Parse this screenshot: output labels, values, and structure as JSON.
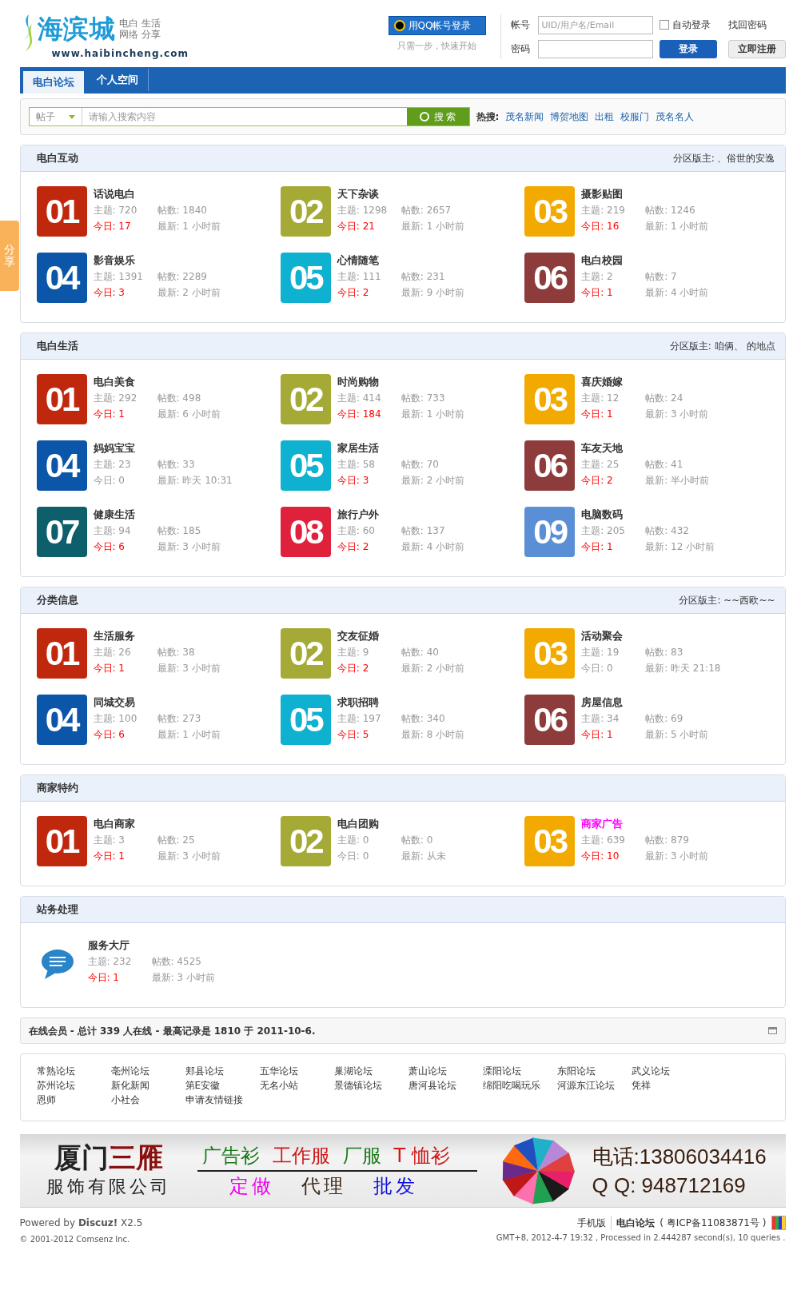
{
  "header": {
    "logo_name": "海滨城",
    "tagline_1": "电白 生活",
    "tagline_2": "网络 分享",
    "url": "www.haibincheng.com",
    "qq_login": "用QQ帐号登录",
    "qq_hint": "只需一步，快速开始",
    "account_label": "帐号",
    "account_placeholder": "UID/用户名/Email",
    "password_label": "密码",
    "auto_login": {
      "label": "自动登录",
      "checked": false
    },
    "forgot": "找回密码",
    "login_button": "登录",
    "register_button": "立即注册"
  },
  "nav": [
    {
      "label": "电白论坛",
      "selected": true
    },
    {
      "label": "个人空间",
      "selected": false
    }
  ],
  "search": {
    "type": "帖子",
    "placeholder": "请输入搜索内容",
    "button": "搜 索",
    "hot_label": "热搜:",
    "hot": [
      "茂名新闻",
      "博贺地图",
      "出租",
      "校服门",
      "茂名名人"
    ]
  },
  "share": "分享",
  "sections": [
    {
      "title": "电白互动",
      "moderators": "分区版主: 、俗世的安逸",
      "forums": [
        {
          "kind": "tile",
          "num": "01",
          "color": "#c0280e",
          "name": "话说电白",
          "topics": "主题: 720",
          "posts": "帖数: 1840",
          "today": "今日: 17",
          "today_active": true,
          "latest": "最新: 1 小时前"
        },
        {
          "kind": "tile",
          "num": "02",
          "color": "#a5aa36",
          "name": "天下杂谈",
          "topics": "主题: 1298",
          "posts": "帖数: 2657",
          "today": "今日: 21",
          "today_active": true,
          "latest": "最新: 1 小时前"
        },
        {
          "kind": "tile",
          "num": "03",
          "color": "#f2aa00",
          "name": "摄影贴图",
          "topics": "主题: 219",
          "posts": "帖数: 1246",
          "today": "今日: 16",
          "today_active": true,
          "latest": "最新: 1 小时前"
        },
        {
          "kind": "tile",
          "num": "04",
          "color": "#0b56a8",
          "name": "影音娱乐",
          "topics": "主题: 1391",
          "posts": "帖数: 2289",
          "today": "今日: 3",
          "today_active": true,
          "latest": "最新: 2 小时前"
        },
        {
          "kind": "tile",
          "num": "05",
          "color": "#0fb1d0",
          "name": "心情随笔",
          "topics": "主题: 111",
          "posts": "帖数: 231",
          "today": "今日: 2",
          "today_active": true,
          "latest": "最新: 9 小时前"
        },
        {
          "kind": "tile",
          "num": "06",
          "color": "#8d3b3b",
          "name": "电白校园",
          "topics": "主题: 2",
          "posts": "帖数: 7",
          "today": "今日: 1",
          "today_active": true,
          "latest": "最新: 4 小时前"
        }
      ]
    },
    {
      "title": "电白生活",
      "moderators": "分区版主: 咱俩、 的地点",
      "forums": [
        {
          "kind": "tile",
          "num": "01",
          "color": "#c0280e",
          "name": "电白美食",
          "topics": "主题: 292",
          "posts": "帖数: 498",
          "today": "今日: 1",
          "today_active": true,
          "latest": "最新: 6 小时前"
        },
        {
          "kind": "tile",
          "num": "02",
          "color": "#a5aa36",
          "name": "时尚购物",
          "topics": "主题: 414",
          "posts": "帖数: 733",
          "today": "今日: 184",
          "today_active": true,
          "latest": "最新: 1 小时前"
        },
        {
          "kind": "tile",
          "num": "03",
          "color": "#f2aa00",
          "name": "喜庆婚嫁",
          "topics": "主题: 12",
          "posts": "帖数: 24",
          "today": "今日: 1",
          "today_active": true,
          "latest": "最新: 3 小时前"
        },
        {
          "kind": "tile",
          "num": "04",
          "color": "#0b56a8",
          "name": "妈妈宝宝",
          "topics": "主题: 23",
          "posts": "帖数: 33",
          "today": "今日: 0",
          "today_active": false,
          "latest": "最新: 昨天 10:31"
        },
        {
          "kind": "tile",
          "num": "05",
          "color": "#0fb1d0",
          "name": "家居生活",
          "topics": "主题: 58",
          "posts": "帖数: 70",
          "today": "今日: 3",
          "today_active": true,
          "latest": "最新: 2 小时前"
        },
        {
          "kind": "tile",
          "num": "06",
          "color": "#8d3b3b",
          "name": "车友天地",
          "topics": "主题: 25",
          "posts": "帖数: 41",
          "today": "今日: 2",
          "today_active": true,
          "latest": "最新: 半小时前"
        },
        {
          "kind": "tile",
          "num": "07",
          "color": "#0c5f6b",
          "name": "健康生活",
          "topics": "主题: 94",
          "posts": "帖数: 185",
          "today": "今日: 6",
          "today_active": true,
          "latest": "最新: 3 小时前"
        },
        {
          "kind": "tile",
          "num": "08",
          "color": "#e0213b",
          "name": "旅行户外",
          "topics": "主题: 60",
          "posts": "帖数: 137",
          "today": "今日: 2",
          "today_active": true,
          "latest": "最新: 4 小时前"
        },
        {
          "kind": "tile",
          "num": "09",
          "color": "#5a8fd5",
          "name": "电脑数码",
          "topics": "主题: 205",
          "posts": "帖数: 432",
          "today": "今日: 1",
          "today_active": true,
          "latest": "最新: 12 小时前"
        }
      ]
    },
    {
      "title": "分类信息",
      "moderators": "分区版主: ~~西欧~~",
      "forums": [
        {
          "kind": "tile",
          "num": "01",
          "color": "#c0280e",
          "name": "生活服务",
          "topics": "主题: 26",
          "posts": "帖数: 38",
          "today": "今日: 1",
          "today_active": true,
          "latest": "最新: 3 小时前"
        },
        {
          "kind": "tile",
          "num": "02",
          "color": "#a5aa36",
          "name": "交友征婚",
          "topics": "主题: 9",
          "posts": "帖数: 40",
          "today": "今日: 2",
          "today_active": true,
          "latest": "最新: 2 小时前"
        },
        {
          "kind": "tile",
          "num": "03",
          "color": "#f2aa00",
          "name": "活动聚会",
          "topics": "主题: 19",
          "posts": "帖数: 83",
          "today": "今日: 0",
          "today_active": false,
          "latest": "最新: 昨天 21:18"
        },
        {
          "kind": "tile",
          "num": "04",
          "color": "#0b56a8",
          "name": "同城交易",
          "topics": "主题: 100",
          "posts": "帖数: 273",
          "today": "今日: 6",
          "today_active": true,
          "latest": "最新: 1 小时前"
        },
        {
          "kind": "tile",
          "num": "05",
          "color": "#0fb1d0",
          "name": "求职招聘",
          "topics": "主题: 197",
          "posts": "帖数: 340",
          "today": "今日: 5",
          "today_active": true,
          "latest": "最新: 8 小时前"
        },
        {
          "kind": "tile",
          "num": "06",
          "color": "#8d3b3b",
          "name": "房屋信息",
          "topics": "主题: 34",
          "posts": "帖数: 69",
          "today": "今日: 1",
          "today_active": true,
          "latest": "最新: 5 小时前"
        }
      ]
    },
    {
      "title": "商家特约",
      "forums": [
        {
          "kind": "tile",
          "num": "01",
          "color": "#c0280e",
          "name": "电白商家",
          "name_highlighted": false,
          "topics": "主题: 3",
          "posts": "帖数: 25",
          "today": "今日: 1",
          "today_active": true,
          "latest": "最新: 3 小时前"
        },
        {
          "kind": "tile",
          "num": "02",
          "color": "#a5aa36",
          "name": "电白团购",
          "name_highlighted": false,
          "topics": "主题: 0",
          "posts": "帖数: 0",
          "today": "今日: 0",
          "today_active": false,
          "latest": "最新: 从未"
        },
        {
          "kind": "tile",
          "num": "03",
          "color": "#f2aa00",
          "name": "商家广告",
          "name_highlighted": true,
          "topics": "主题: 639",
          "posts": "帖数: 879",
          "today": "今日: 10",
          "today_active": true,
          "latest": "最新: 3 小时前"
        }
      ]
    },
    {
      "title": "站务处理",
      "forums": [
        {
          "kind": "icon",
          "name": "服务大厅",
          "topics": "主题: 232",
          "posts": "帖数: 4525",
          "today": "今日: 1",
          "today_active": true,
          "latest": "最新: 3 小时前"
        }
      ]
    }
  ],
  "online": "在线会员 - 总计 339 人在线 - 最高记录是 1810 于 2011-10-6.",
  "links": [
    "常熟论坛",
    "亳州论坛",
    "郏县论坛",
    "五华论坛",
    "巢湖论坛",
    "萧山论坛",
    "溧阳论坛",
    "东阳论坛",
    "武义论坛",
    "苏州论坛",
    "新化新闻",
    "第E安徽",
    "无名小站",
    "景德镇论坛",
    "唐河县论坛",
    "绵阳吃喝玩乐",
    "河源东江论坛",
    "凭祥",
    "恩师",
    "小社会",
    "申请友情链接"
  ],
  "banner": {
    "company_1": "厦门",
    "company_2": "三雁",
    "company_sub": "服饰有限公司",
    "products": [
      {
        "text": "广告衫",
        "color": "#1a7a1a"
      },
      {
        "text": "工作服",
        "color": "#d01818"
      },
      {
        "text": "厂服",
        "color": "#1a7a1a"
      },
      {
        "text": "T 恤衫",
        "color": "#d01818"
      }
    ],
    "services": [
      {
        "text": "定做",
        "color": "#ee00ee"
      },
      {
        "text": "代理",
        "color": "#3a2a1a"
      },
      {
        "text": "批发",
        "color": "#1010dd"
      }
    ],
    "phone": "电话:13806034416",
    "qq": "Q Q: 948712169"
  },
  "footer": {
    "powered": "Powered by **Discuz!** X2.5",
    "copyright": "© 2001-2012 Comsenz Inc.",
    "mobile": "手机版",
    "forum": "电白论坛",
    "icp": "( 粤ICP备11083871号 )",
    "stats": "GMT+8, 2012-4-7 19:32 , Processed in 2.444287 second(s), 10 queries ."
  }
}
